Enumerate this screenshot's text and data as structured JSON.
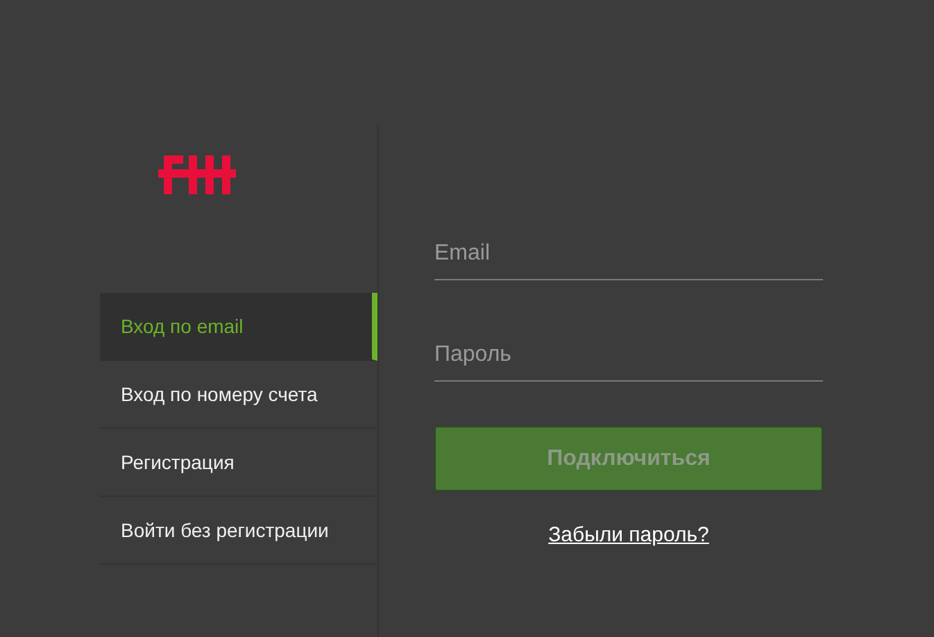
{
  "menu": [
    {
      "label": "Вход по email",
      "selected": true
    },
    {
      "label": "Вход по номеру счета",
      "selected": false
    },
    {
      "label": "Регистрация",
      "selected": false
    },
    {
      "label": "Войти без регистрации",
      "selected": false
    }
  ],
  "fields": [
    {
      "placeholder": "Email"
    },
    {
      "placeholder": "Пароль"
    }
  ],
  "submit": {
    "label": "Подключиться",
    "disabled": true
  },
  "forgot_link": "Забыли пароль?"
}
